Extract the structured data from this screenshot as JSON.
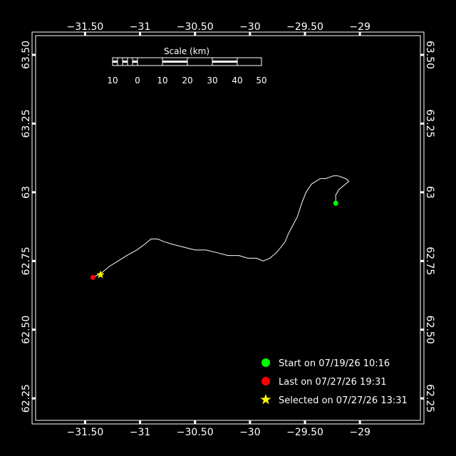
{
  "map": {
    "background": "#000000",
    "frame_color": "#ffffff",
    "track_color": "#ffffff",
    "lon_range": [
      -31.95,
      -28.45
    ],
    "lat_range": [
      62.17,
      63.57
    ],
    "lon_ticks": [
      {
        "value": -31.5,
        "label": "−31.50"
      },
      {
        "value": -31.0,
        "label": "−31"
      },
      {
        "value": -30.5,
        "label": "−30.50"
      },
      {
        "value": -30.0,
        "label": "−30"
      },
      {
        "value": -29.5,
        "label": "−29.50"
      },
      {
        "value": -29.0,
        "label": "−29"
      }
    ],
    "lat_ticks": [
      {
        "value": 62.25,
        "label": "62.25"
      },
      {
        "value": 62.5,
        "label": "62.50"
      },
      {
        "value": 62.75,
        "label": "62.75"
      },
      {
        "value": 63.0,
        "label": "63"
      },
      {
        "value": 63.25,
        "label": "63.25"
      },
      {
        "value": 63.5,
        "label": "63.50"
      }
    ],
    "track": [
      [
        -29.22,
        62.96
      ],
      [
        -29.22,
        62.99
      ],
      [
        -29.19,
        63.01
      ],
      [
        -29.13,
        63.03
      ],
      [
        -29.1,
        63.04
      ],
      [
        -29.13,
        63.05
      ],
      [
        -29.2,
        63.06
      ],
      [
        -29.24,
        63.06
      ],
      [
        -29.31,
        63.05
      ],
      [
        -29.36,
        63.05
      ],
      [
        -29.44,
        63.03
      ],
      [
        -29.49,
        63.0
      ],
      [
        -29.53,
        62.96
      ],
      [
        -29.57,
        62.91
      ],
      [
        -29.61,
        62.88
      ],
      [
        -29.65,
        62.85
      ],
      [
        -29.68,
        62.82
      ],
      [
        -29.72,
        62.8
      ],
      [
        -29.76,
        62.78
      ],
      [
        -29.82,
        62.76
      ],
      [
        -29.88,
        62.75
      ],
      [
        -29.94,
        62.76
      ],
      [
        -30.02,
        62.76
      ],
      [
        -30.1,
        62.77
      ],
      [
        -30.2,
        62.77
      ],
      [
        -30.3,
        62.78
      ],
      [
        -30.4,
        62.79
      ],
      [
        -30.5,
        62.79
      ],
      [
        -30.6,
        62.8
      ],
      [
        -30.7,
        62.81
      ],
      [
        -30.78,
        62.82
      ],
      [
        -30.84,
        62.83
      ],
      [
        -30.9,
        62.83
      ],
      [
        -30.96,
        62.81
      ],
      [
        -31.03,
        62.79
      ],
      [
        -31.12,
        62.77
      ],
      [
        -31.2,
        62.75
      ],
      [
        -31.28,
        62.73
      ],
      [
        -31.34,
        62.71
      ],
      [
        -31.38,
        62.7
      ],
      [
        -31.43,
        62.69
      ]
    ],
    "markers": {
      "start": {
        "lon": -29.22,
        "lat": 62.96,
        "color": "#00ff00"
      },
      "last": {
        "lon": -31.43,
        "lat": 62.69,
        "color": "#ff0000"
      },
      "selected": {
        "lon": -31.36,
        "lat": 62.7,
        "color": "#ffff00"
      }
    }
  },
  "scale_bar": {
    "title": "Scale (km)",
    "labels": [
      "10",
      "0",
      "10",
      "20",
      "30",
      "40",
      "50"
    ]
  },
  "legend": {
    "start_label": "Start on 07/19/26 10:16",
    "last_label": "Last on 07/27/26 19:31",
    "selected_label": "Selected on 07/27/26 13:31"
  }
}
